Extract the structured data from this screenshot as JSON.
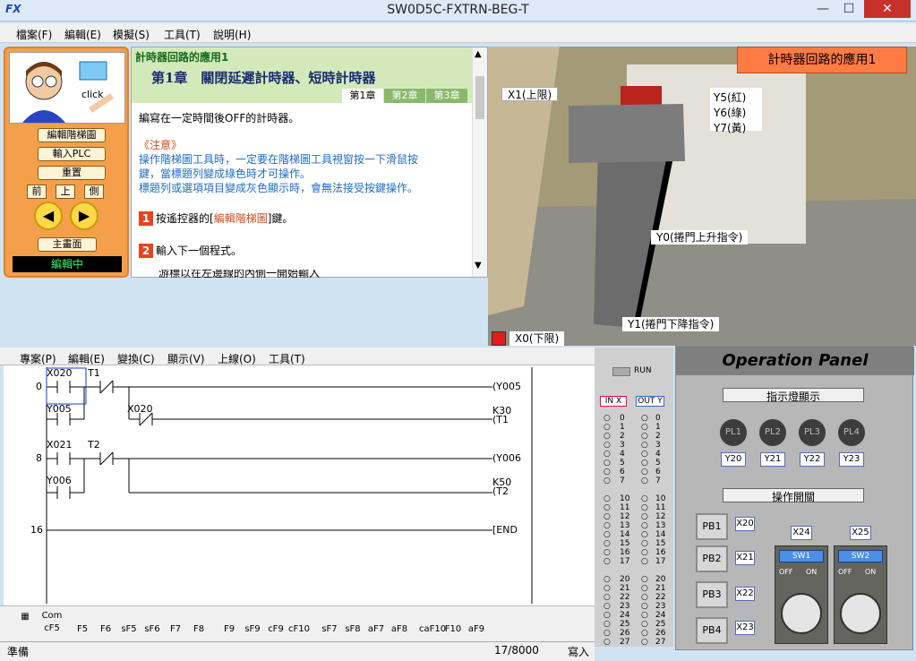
{
  "window": {
    "title": "SW0D5C-FXTRN-BEG-T",
    "icon": "fx-app-icon"
  },
  "menu": [
    "檔案(F)",
    "編輯(E)",
    "模擬(S)",
    "工具(T)",
    "說明(H)"
  ],
  "tutor": {
    "avatar_caption": "click",
    "buttons": [
      "編輯階梯圖",
      "輸入PLC",
      "重置"
    ],
    "nav": [
      "前",
      "上",
      "側"
    ],
    "home": "主畫面",
    "status": "編輯中"
  },
  "lesson": {
    "section": "計時器回路的應用1",
    "chapter": "第1章　關閉延遲計時器、短時計時器",
    "tabs": [
      "第1章",
      "第2章",
      "第3章"
    ],
    "intro": "編寫在一定時間後OFF的計時器。",
    "note_title": "《注意》",
    "note_lines": [
      "操作階梯圖工具時，一定要在階梯圖工具視窗按一下滑鼠按",
      "鍵，當標題列變成綠色時才可操作。",
      "標題列或選項項目變成灰色顯示時，會無法接受按鍵操作。"
    ],
    "step1_num": "1",
    "step1_pre": "按遙控器的[",
    "step1_link": "編輯階梯圖",
    "step1_post": "]鍵。",
    "step2_num": "2",
    "step2": "輸入下一個程式。",
    "step3_partial": "游標以在左邊線的內側一開始輸入"
  },
  "scene": {
    "title": "計時器回路的應用1",
    "x1": "X1(上限)",
    "y5": "Y5(紅)",
    "y6": "Y6(綠)",
    "y7": "Y7(黃)",
    "y0": "Y0(捲門上升指令)",
    "y1": "Y1(捲門下降指令)",
    "x0": "X0(下限)"
  },
  "ladder_menu": [
    "專案(P)",
    "編輯(E)",
    "變換(C)",
    "顯示(V)",
    "上線(O)",
    "工具(T)"
  ],
  "ladder": {
    "step_nums": [
      "0",
      "8",
      "16"
    ],
    "c1": "X020",
    "c2": "T1",
    "c3": "Y005",
    "c4": "X020",
    "c5": "X021",
    "c6": "T2",
    "c7": "Y006",
    "out1": "(Y005",
    "out2": "K30",
    "out3": "(T1",
    "out4": "(Y006",
    "out5": "K50",
    "out6": "(T2",
    "end": "[END"
  },
  "fkeys": [
    "F5",
    "F6",
    "sF5",
    "sF6",
    "F7",
    "F8",
    "F9",
    "sF9",
    "cF9",
    "cF10",
    "sF7",
    "sF8",
    "aF7",
    "aF8",
    "caF10",
    "F10",
    "aF9"
  ],
  "fkey_first": "cF5",
  "fkey_first_label": "Com",
  "statusbar": {
    "left": "準備",
    "count": "17/8000",
    "mode": "寫入"
  },
  "io": {
    "run": "RUN",
    "in_label": "IN X",
    "out_label": "OUT Y",
    "rows": [
      "0",
      "1",
      "2",
      "3",
      "4",
      "5",
      "6",
      "7",
      "10",
      "11",
      "12",
      "13",
      "14",
      "15",
      "16",
      "17",
      "20",
      "21",
      "22",
      "23",
      "24",
      "25",
      "26",
      "27"
    ]
  },
  "panel": {
    "title": "Operation Panel",
    "indicator": "指示燈顯示",
    "lights": [
      "PL1",
      "PL2",
      "PL3",
      "PL4"
    ],
    "light_addr": [
      "Y20",
      "Y21",
      "Y22",
      "Y23"
    ],
    "switch_title": "操作開關",
    "pbs": [
      "PB1",
      "PB2",
      "PB3",
      "PB4"
    ],
    "pb_addr": [
      "X20",
      "X21",
      "X22",
      "X23"
    ],
    "sw_addr": [
      "X24",
      "X25"
    ],
    "sw": [
      "SW1",
      "SW2"
    ],
    "off": "OFF",
    "on": "ON"
  }
}
